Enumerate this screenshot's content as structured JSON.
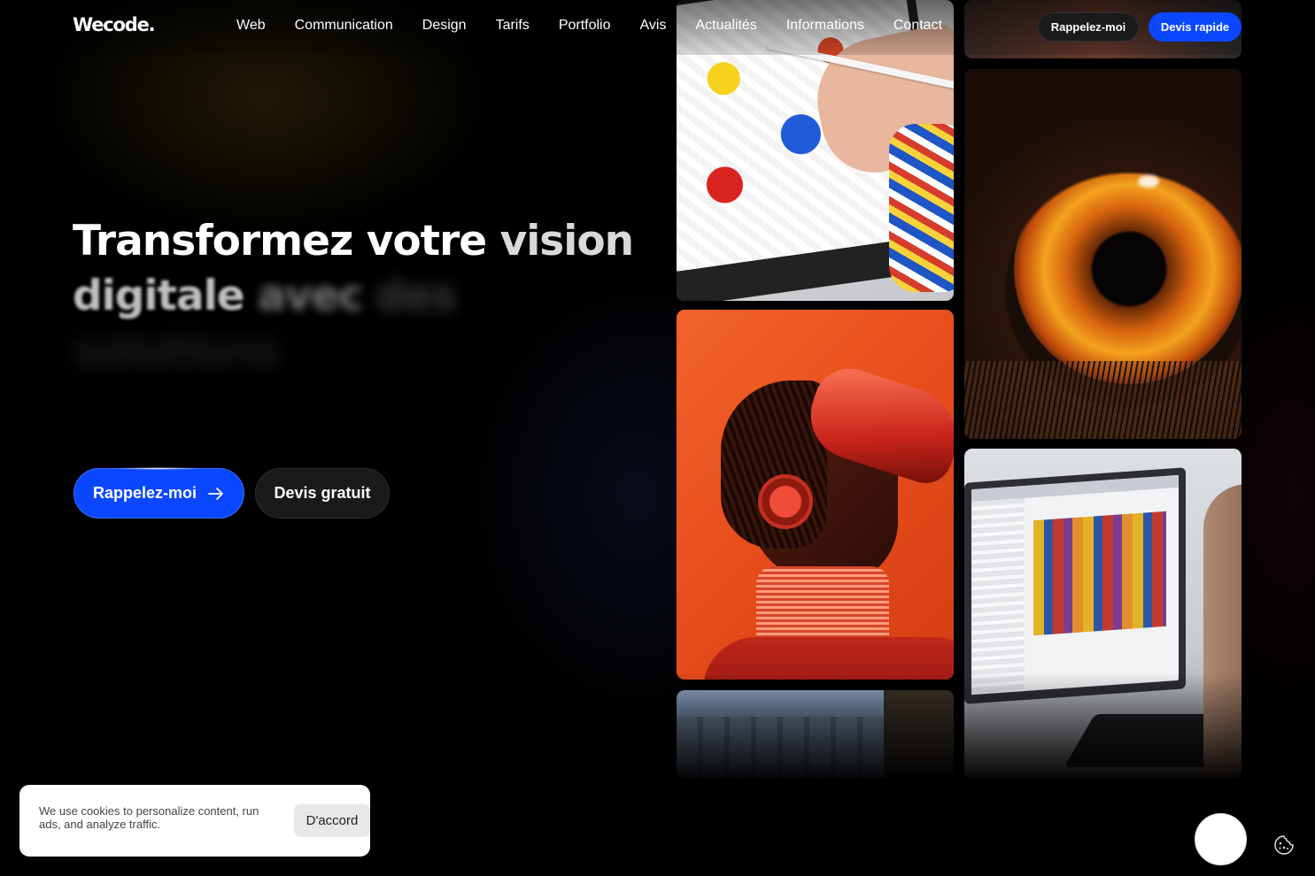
{
  "brand": {
    "logo": "Wecode."
  },
  "nav": {
    "items": [
      "Web",
      "Communication",
      "Design",
      "Tarifs",
      "Portfolio",
      "Avis",
      "Actualités",
      "Informations",
      "Contact"
    ]
  },
  "header_actions": {
    "callback": "Rappelez-moi",
    "quick_quote": "Devis rapide"
  },
  "hero": {
    "title_words": [
      "Transformez",
      "votre",
      "vision",
      "digitale",
      "avec",
      "des",
      "solutions"
    ],
    "cta_primary": "Rappelez-moi",
    "cta_secondary": "Devis gratuit",
    "cta_primary_icon": "arrow-right-icon"
  },
  "cookie_banner": {
    "text": "We use cookies to personalize content, run ads, and analyze traffic.",
    "accept": "D'accord"
  },
  "colors": {
    "accent": "#0a47ff",
    "background": "#000000",
    "secondary_button": "#1a1a1d"
  },
  "icons": {
    "cookie_settings": "cookie-icon",
    "chat": "chat-bubble"
  }
}
